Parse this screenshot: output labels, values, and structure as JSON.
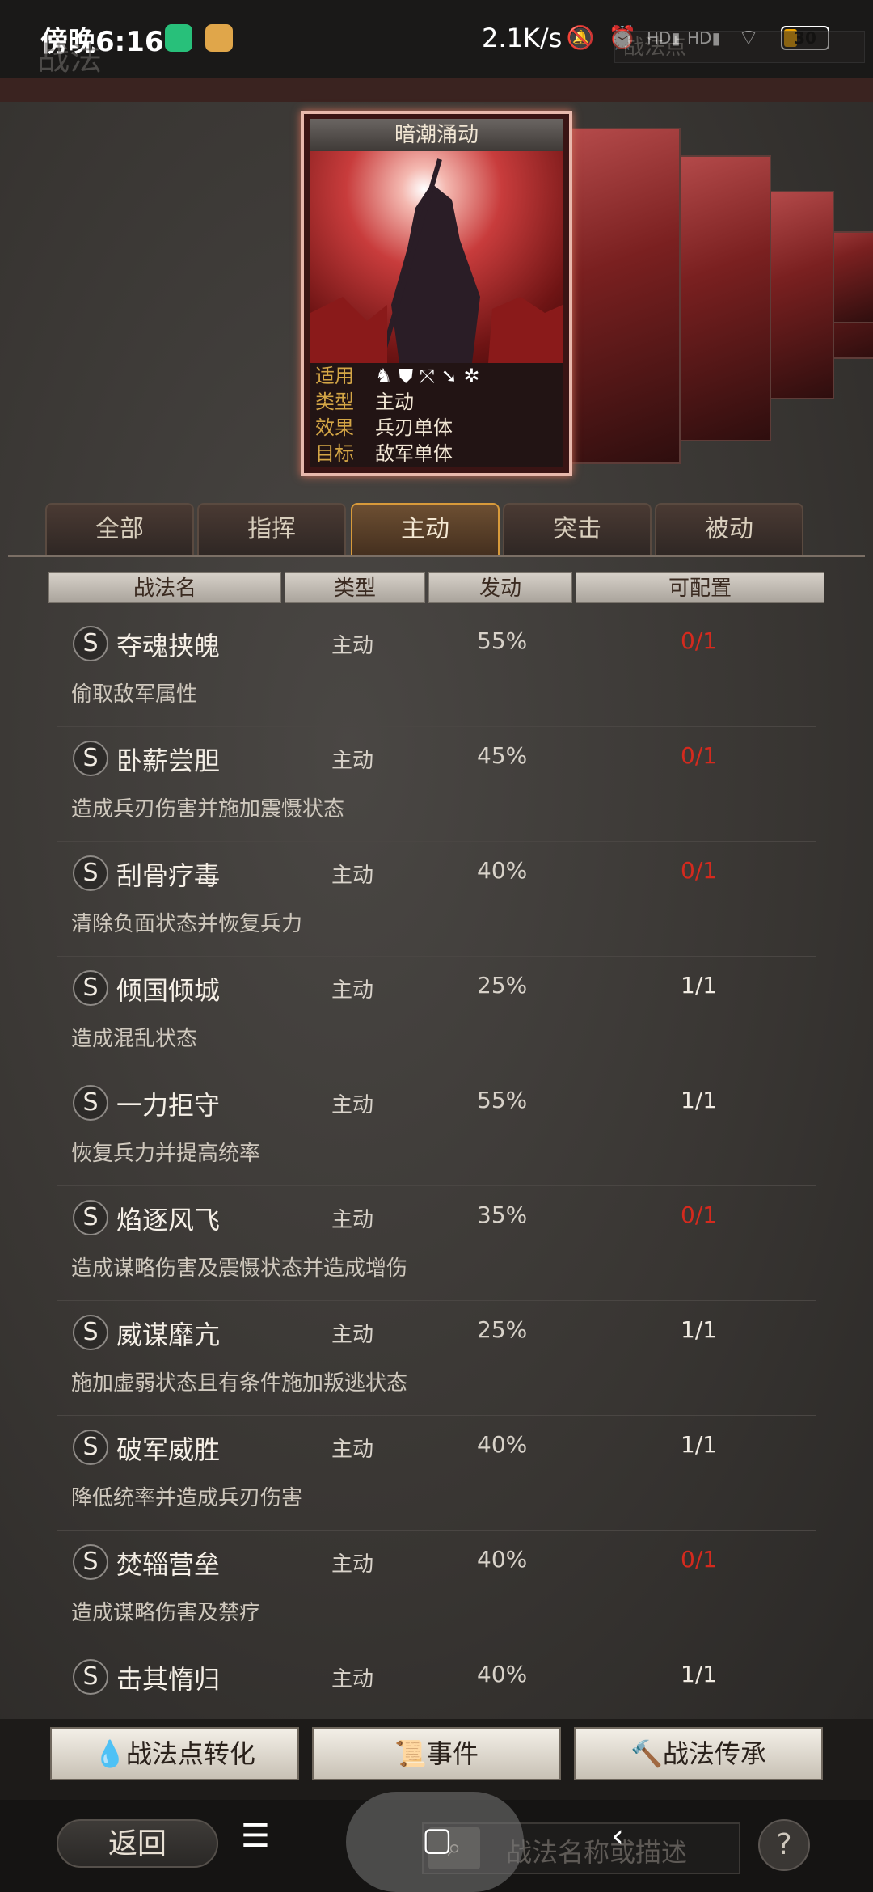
{
  "status_bar": {
    "time": "傍晚6:16",
    "net_speed": "2.1K/s",
    "battery": "30",
    "battery_fraction": 0.3
  },
  "header": {
    "title": "战法",
    "points_label": "战法点"
  },
  "card": {
    "name": "暗潮涌动",
    "rows": [
      {
        "key": "适用",
        "value": ""
      },
      {
        "key": "类型",
        "value": "主动"
      },
      {
        "key": "效果",
        "value": "兵刃单体"
      },
      {
        "key": "目标",
        "value": "敌军单体"
      }
    ],
    "suit_icons": [
      "cavalry-icon",
      "shield-icon",
      "bow-icon",
      "spear-icon",
      "siege-icon"
    ]
  },
  "tabs": [
    {
      "label": "全部"
    },
    {
      "label": "指挥"
    },
    {
      "label": "主动"
    },
    {
      "label": "突击"
    },
    {
      "label": "被动"
    }
  ],
  "table_headers": [
    "战法名",
    "类型",
    "发动",
    "可配置"
  ],
  "rows": [
    {
      "rank": "S",
      "name": "夺魂挟魄",
      "type": "主动",
      "rate": "55%",
      "config": "0/1",
      "desc": "偷取敌军属性",
      "warn": true
    },
    {
      "rank": "S",
      "name": "卧薪尝胆",
      "type": "主动",
      "rate": "45%",
      "config": "0/1",
      "desc": "造成兵刃伤害并施加震慑状态",
      "warn": true
    },
    {
      "rank": "S",
      "name": "刮骨疗毒",
      "type": "主动",
      "rate": "40%",
      "config": "0/1",
      "desc": "清除负面状态并恢复兵力",
      "warn": true
    },
    {
      "rank": "S",
      "name": "倾国倾城",
      "type": "主动",
      "rate": "25%",
      "config": "1/1",
      "desc": "造成混乱状态",
      "warn": false
    },
    {
      "rank": "S",
      "name": "一力拒守",
      "type": "主动",
      "rate": "55%",
      "config": "1/1",
      "desc": "恢复兵力并提高统率",
      "warn": false
    },
    {
      "rank": "S",
      "name": "焰逐风飞",
      "type": "主动",
      "rate": "35%",
      "config": "0/1",
      "desc": "造成谋略伤害及震慑状态并造成增伤",
      "warn": true
    },
    {
      "rank": "S",
      "name": "威谋靡亢",
      "type": "主动",
      "rate": "25%",
      "config": "1/1",
      "desc": "施加虚弱状态且有条件施加叛逃状态",
      "warn": false
    },
    {
      "rank": "S",
      "name": "破军威胜",
      "type": "主动",
      "rate": "40%",
      "config": "1/1",
      "desc": "降低统率并造成兵刃伤害",
      "warn": false
    },
    {
      "rank": "S",
      "name": "焚辎营垒",
      "type": "主动",
      "rate": "40%",
      "config": "0/1",
      "desc": "造成谋略伤害及禁疗",
      "warn": true
    },
    {
      "rank": "S",
      "name": "击其惰归",
      "type": "主动",
      "rate": "40%",
      "config": "1/1",
      "desc": "",
      "warn": false
    }
  ],
  "buttons": {
    "convert": "战法点转化",
    "event": "事件",
    "inherit": "战法传承"
  },
  "bottom": {
    "back": "返回",
    "search_placeholder": "战法名称或描述",
    "help": "?"
  },
  "colors": {
    "warn": "#d42a1e",
    "ok": "#f2ece3",
    "accent": "#d89a3a"
  }
}
